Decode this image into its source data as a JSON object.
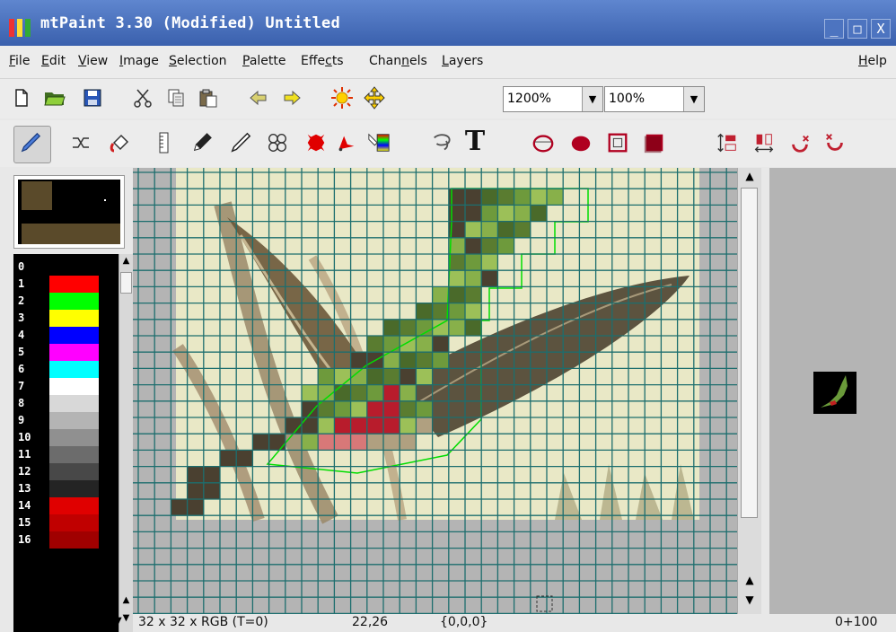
{
  "window": {
    "title": "mtPaint 3.30 (Modified) Untitled",
    "minimize_label": "_",
    "maximize_label": "□",
    "close_label": "X"
  },
  "menu": {
    "items": [
      "File",
      "Edit",
      "View",
      "Image",
      "Selection",
      "Palette",
      "Effects",
      "Channels",
      "Layers"
    ],
    "help": "Help"
  },
  "toolbar": {
    "zoom_value": "1200%",
    "opacity_value": "100%"
  },
  "palette": {
    "entries": [
      {
        "index": "0",
        "color": "#000000"
      },
      {
        "index": "1",
        "color": "#ff0000"
      },
      {
        "index": "2",
        "color": "#00ff00"
      },
      {
        "index": "3",
        "color": "#ffff00"
      },
      {
        "index": "4",
        "color": "#0000ff"
      },
      {
        "index": "5",
        "color": "#ff00ff"
      },
      {
        "index": "6",
        "color": "#00ffff"
      },
      {
        "index": "7",
        "color": "#ffffff"
      },
      {
        "index": "8",
        "color": "#d8d8d8"
      },
      {
        "index": "9",
        "color": "#b4b4b4"
      },
      {
        "index": "10",
        "color": "#909090"
      },
      {
        "index": "11",
        "color": "#6c6c6c"
      },
      {
        "index": "12",
        "color": "#484848"
      },
      {
        "index": "13",
        "color": "#242424"
      },
      {
        "index": "14",
        "color": "#e00000"
      },
      {
        "index": "15",
        "color": "#c00000"
      },
      {
        "index": "16",
        "color": "#a00000"
      }
    ]
  },
  "status": {
    "image_info": "32 x 32 x RGB  (T=0)",
    "cursor_pos": "22,26",
    "pixel_value": "{0,0,0}",
    "zoom_info": "0+100"
  },
  "colors": {
    "grid": "#1d6e6e",
    "selection": "#00dd00",
    "canvas_bg": "#b4b4b4"
  }
}
